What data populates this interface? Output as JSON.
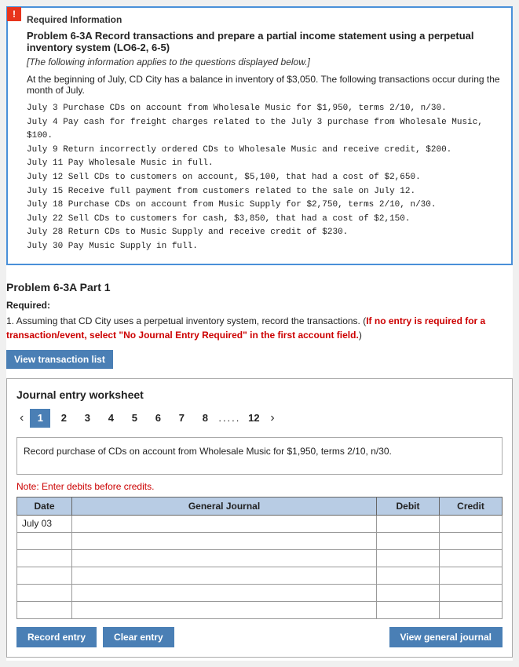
{
  "exclamation": "!",
  "required_info": {
    "label": "Required Information",
    "problem_title": "Problem 6-3A Record transactions and prepare a partial income statement using a perpetual inventory system (LO6-2, 6-5)",
    "italic_note": "[The following information applies to the questions displayed below.]",
    "intro": "At the beginning of July, CD City has a balance in inventory of $3,050. The following transactions occur during the month of July.",
    "transactions": [
      "July  3  Purchase CDs on account from Wholesale Music for $1,950, terms 2/10, n/30.",
      "July  4  Pay cash for freight charges related to the July 3 purchase from Wholesale Music, $100.",
      "July  9  Return incorrectly ordered CDs to Wholesale Music and receive credit, $200.",
      "July 11  Pay Wholesale Music in full.",
      "July 12  Sell CDs to customers on account, $5,100, that had a cost of $2,650.",
      "July 15  Receive full payment from customers related to the sale on July 12.",
      "July 18  Purchase CDs on account from Music Supply for $2,750, terms 2/10, n/30.",
      "July 22  Sell CDs to customers for cash, $3,850, that had a cost of $2,150.",
      "July 28  Return CDs to Music Supply and receive credit of $230.",
      "July 30  Pay Music Supply in full."
    ]
  },
  "problem_part": {
    "title": "Problem 6-3A Part 1",
    "required_label": "Required:",
    "instruction_plain": "1. Assuming that CD City uses a perpetual inventory system, record the transactions. (",
    "instruction_red": "If no entry is required for a transaction/event, select \"No Journal Entry Required\" in the first account field.",
    "instruction_close": ")"
  },
  "view_transaction_btn": "View transaction list",
  "worksheet": {
    "title": "Journal entry worksheet",
    "pages": [
      "1",
      "2",
      "3",
      "4",
      "5",
      "6",
      "7",
      "8",
      ".....",
      "12"
    ],
    "active_page": "1",
    "description": "Record purchase of CDs on account from Wholesale Music for $1,950, terms 2/10, n/30.",
    "note": "Note: Enter debits before credits.",
    "table": {
      "headers": [
        "Date",
        "General Journal",
        "Debit",
        "Credit"
      ],
      "rows": [
        {
          "date": "July 03",
          "general": "",
          "debit": "",
          "credit": ""
        },
        {
          "date": "",
          "general": "",
          "debit": "",
          "credit": ""
        },
        {
          "date": "",
          "general": "",
          "debit": "",
          "credit": ""
        },
        {
          "date": "",
          "general": "",
          "debit": "",
          "credit": ""
        },
        {
          "date": "",
          "general": "",
          "debit": "",
          "credit": ""
        },
        {
          "date": "",
          "general": "",
          "debit": "",
          "credit": ""
        }
      ]
    }
  },
  "buttons": {
    "record_entry": "Record entry",
    "clear_entry": "Clear entry",
    "view_general_journal": "View general journal"
  }
}
